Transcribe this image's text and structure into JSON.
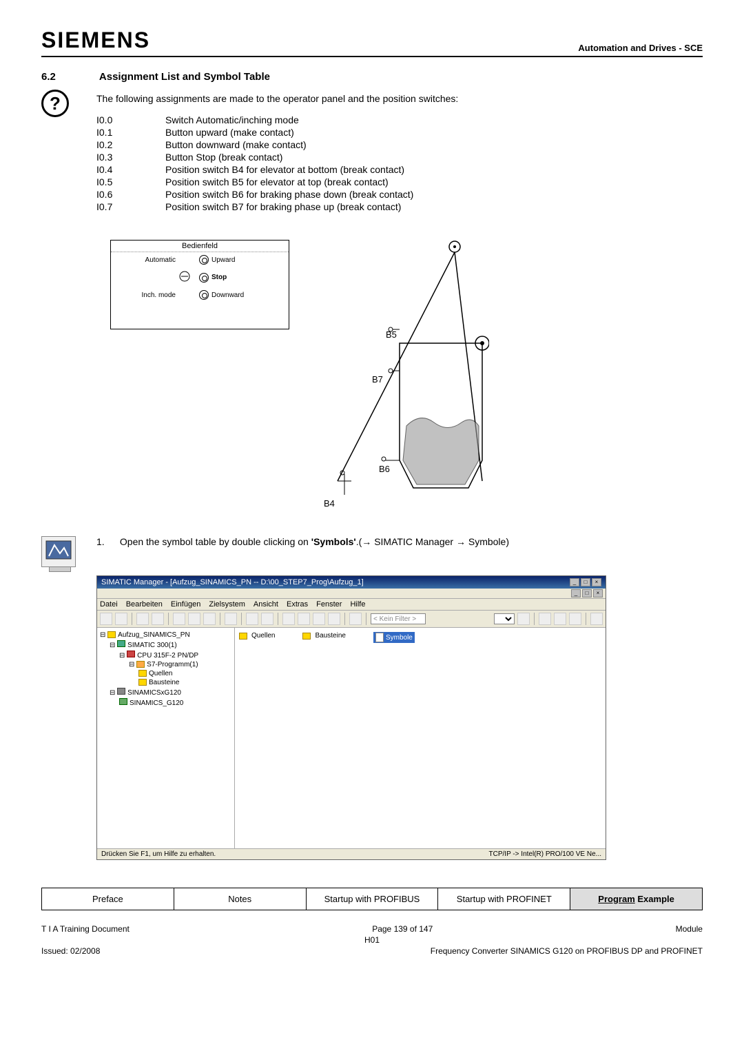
{
  "header": {
    "logo": "SIEMENS",
    "right": "Automation and Drives - SCE"
  },
  "section": {
    "number": "6.2",
    "title": "Assignment List and Symbol Table"
  },
  "intro": "The following assignments are made to the operator panel and the position switches:",
  "assignments": [
    {
      "code": "I0.0",
      "desc": "Switch Automatic/inching mode"
    },
    {
      "code": "I0.1",
      "desc": "Button upward (make contact)"
    },
    {
      "code": "I0.2",
      "desc": "Button downward (make contact)"
    },
    {
      "code": "I0.3",
      "desc": "Button Stop (break contact)"
    },
    {
      "code": "I0.4",
      "desc": "Position switch B4 for elevator at bottom (break contact)"
    },
    {
      "code": "I0.5",
      "desc": "Position switch B5 for elevator at top (break contact)"
    },
    {
      "code": "I0.6",
      "desc": "Position switch B6 for braking phase down (break contact)"
    },
    {
      "code": "I0.7",
      "desc": "Position switch B7 for braking phase up (break contact)"
    }
  ],
  "diagram": {
    "bedienfeld": "Bedienfeld",
    "automatic": "Automatic",
    "inchmode": "Inch. mode",
    "upward": "Upward",
    "stop": "Stop",
    "downward": "Downward",
    "b4": "B4",
    "b5": "B5",
    "b6": "B6",
    "b7": "B7"
  },
  "step": {
    "num": "1.",
    "text_before": "Open the symbol table by double clicking on ",
    "bold": "'Symbols'",
    "text_after": ".(→ SIMATIC Manager → Symbole)"
  },
  "screenshot": {
    "title": "SIMATIC Manager - [Aufzug_SINAMICS_PN -- D:\\00_STEP7_Prog\\Aufzug_1]",
    "menu": [
      "Datei",
      "Bearbeiten",
      "Einfügen",
      "Zielsystem",
      "Ansicht",
      "Extras",
      "Fenster",
      "Hilfe"
    ],
    "filter_placeholder": "< Kein Filter >",
    "tree": [
      {
        "indent": 0,
        "label": "Aufzug_SINAMICS_PN"
      },
      {
        "indent": 1,
        "label": "SIMATIC 300(1)"
      },
      {
        "indent": 2,
        "label": "CPU 315F-2 PN/DP"
      },
      {
        "indent": 3,
        "label": "S7-Programm(1)"
      },
      {
        "indent": 4,
        "label": "Quellen"
      },
      {
        "indent": 4,
        "label": "Bausteine"
      },
      {
        "indent": 1,
        "label": "SINAMICSxG120"
      },
      {
        "indent": 2,
        "label": "SINAMICS_G120"
      }
    ],
    "content_items": [
      {
        "label": "Quellen",
        "selected": false
      },
      {
        "label": "Bausteine",
        "selected": false
      },
      {
        "label": "Symbole",
        "selected": true
      }
    ],
    "status_left": "Drücken Sie F1, um Hilfe zu erhalten.",
    "status_right": "TCP/IP -> Intel(R) PRO/100 VE Ne..."
  },
  "tabs": {
    "items": [
      "Preface",
      "Notes",
      "Startup with PROFIBUS",
      "Startup with PROFINET"
    ],
    "active_prefix": "Program",
    "active_rest": " Example"
  },
  "footer": {
    "left1": "T I A  Training Document",
    "center1": "Page 139 of 147",
    "right1": "Module",
    "center2": "H01",
    "left2": "Issued: 02/2008",
    "right2": "Frequency Converter SINAMICS G120 on PROFIBUS DP and PROFINET"
  }
}
